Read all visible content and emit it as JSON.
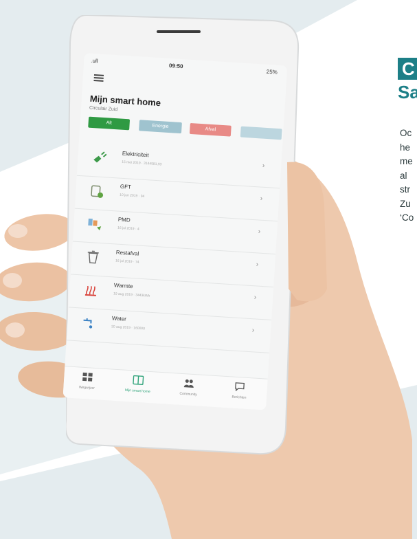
{
  "side": {
    "title_highlight": "C",
    "title_rest": "Sa",
    "paragraph_lines": [
      "Oc",
      "he",
      "me",
      "al",
      "str",
      "Zu",
      "‘Co"
    ]
  },
  "statusbar": {
    "signal": ".ull",
    "time": "09:50",
    "battery": "25%"
  },
  "app": {
    "title": "Mijn smart home",
    "subtitle": "Circulair Zuid",
    "filters": [
      {
        "label": "Alt",
        "color": "#2f9a43"
      },
      {
        "label": "Energie",
        "color": "#9fc3cf"
      },
      {
        "label": "Afval",
        "color": "#e88a86"
      }
    ],
    "items": [
      {
        "name": "Elektriciteit",
        "meta": "15 mei 2019 · 3144581,93",
        "icon": "plug-icon"
      },
      {
        "name": "GFT",
        "meta": "10 jun 2019 · 94",
        "icon": "organic-bin-icon"
      },
      {
        "name": "PMD",
        "meta": "16 jul 2019 · 4",
        "icon": "recycle-icon"
      },
      {
        "name": "Restafval",
        "meta": "16 jul 2019 · 74",
        "icon": "trash-icon"
      },
      {
        "name": "Warmte",
        "meta": "19 aug 2019 · 3443kWh",
        "icon": "heat-icon"
      },
      {
        "name": "Water",
        "meta": "20 aug 2019 · 160000",
        "icon": "water-tap-icon"
      }
    ],
    "tabs": [
      {
        "label": "Wegwijzer",
        "icon": "grid-icon"
      },
      {
        "label": "Mijn smart home",
        "icon": "dashboard-icon"
      },
      {
        "label": "Community",
        "icon": "people-icon"
      },
      {
        "label": "Berichten",
        "icon": "chat-icon"
      }
    ]
  },
  "colors": {
    "accent": "#1d7f87",
    "active_tab": "#2fa37a"
  }
}
